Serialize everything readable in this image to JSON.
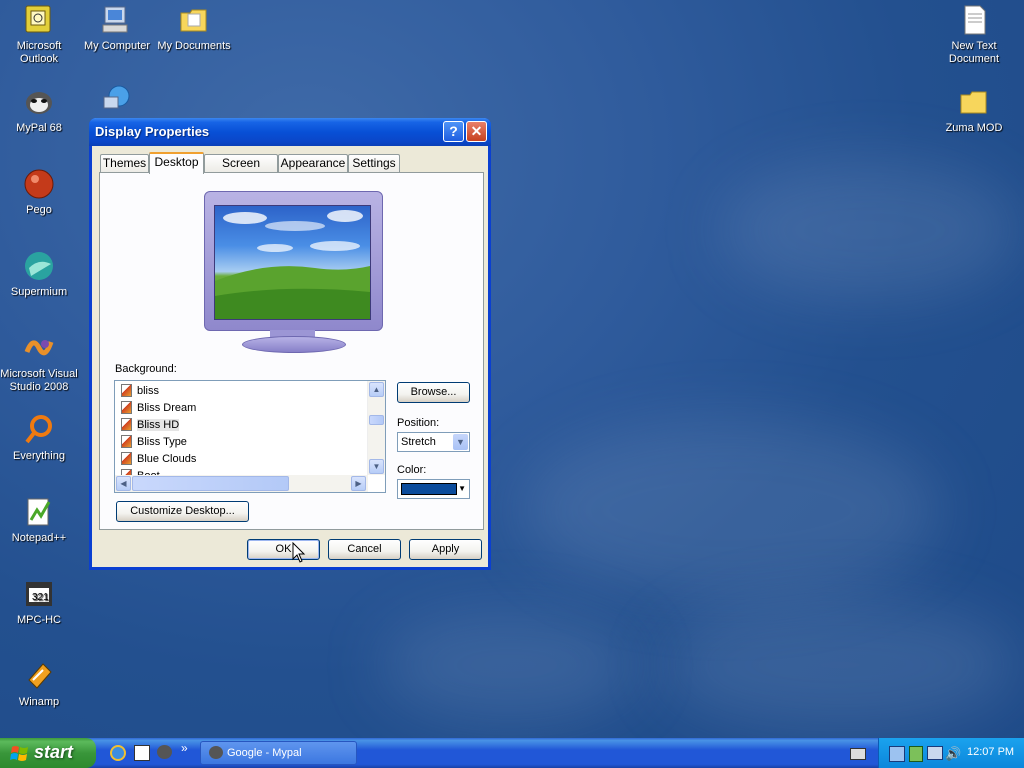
{
  "desktop": {
    "icons": [
      {
        "label": "Microsoft\nOutlook",
        "name": "outlook"
      },
      {
        "label": "My Computer",
        "name": "my-computer"
      },
      {
        "label": "My Documents",
        "name": "my-documents"
      },
      {
        "label": "MyPal 68",
        "name": "mypal"
      },
      {
        "label": "Pego",
        "name": "pego"
      },
      {
        "label": "Supermium",
        "name": "supermium"
      },
      {
        "label": "Microsoft Visual Studio 2008",
        "name": "visual-studio"
      },
      {
        "label": "Everything",
        "name": "everything"
      },
      {
        "label": "Notepad++",
        "name": "notepadpp"
      },
      {
        "label": "MPC-HC",
        "name": "mpc-hc"
      },
      {
        "label": "Winamp",
        "name": "winamp"
      },
      {
        "label": "New Text Document",
        "name": "new-text-document"
      },
      {
        "label": "Zuma MOD",
        "name": "zuma-mod"
      }
    ]
  },
  "window": {
    "title": "Display Properties",
    "tabs": [
      "Themes",
      "Desktop",
      "Screen Saver",
      "Appearance",
      "Settings"
    ],
    "active_tab": "Desktop",
    "background_label": "Background:",
    "backgrounds": [
      "bliss",
      "Bliss Dream",
      "Bliss HD",
      "Bliss Type",
      "Blue Clouds",
      "Boot"
    ],
    "selected_background": "Bliss HD",
    "browse_label": "Browse...",
    "position_label": "Position:",
    "position_value": "Stretch",
    "color_label": "Color:",
    "color_value": "#0b4c9c",
    "customize_label": "Customize Desktop...",
    "ok_label": "OK",
    "cancel_label": "Cancel",
    "apply_label": "Apply"
  },
  "taskbar": {
    "start_label": "start",
    "task_label": "Google - Mypal",
    "clock": "12:07 PM"
  }
}
